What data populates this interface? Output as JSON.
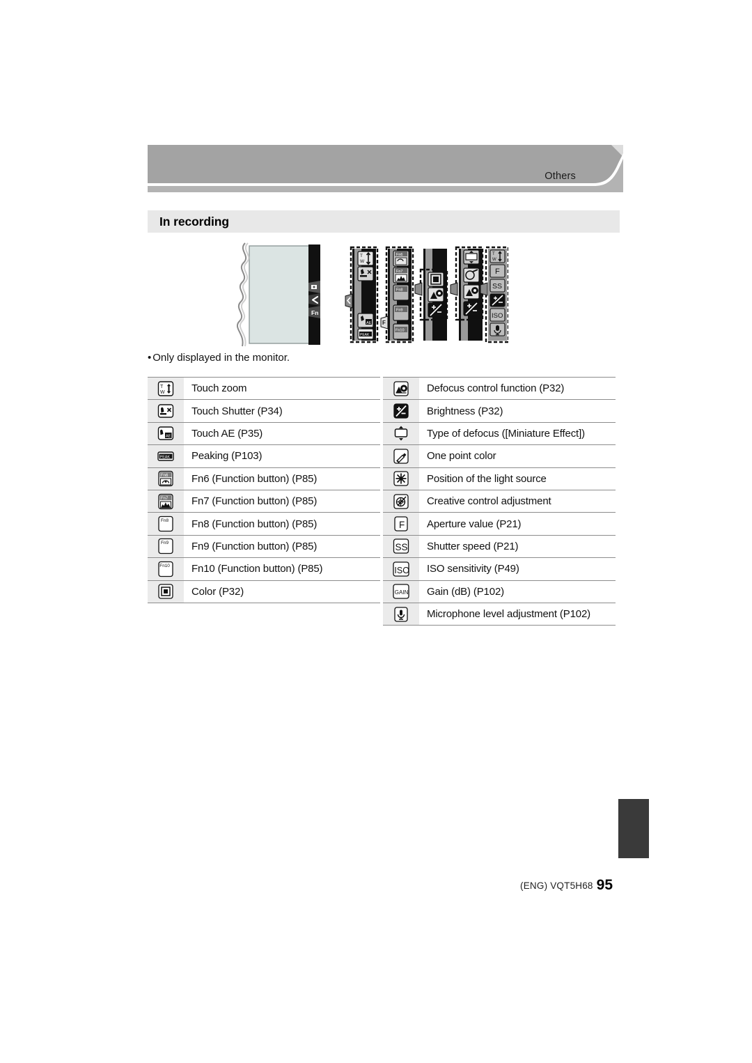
{
  "header": {
    "chapter_label": "Others"
  },
  "section": {
    "title": "In recording"
  },
  "note": {
    "bullet": "•",
    "text": "Only displayed in the monitor."
  },
  "illustration": {
    "monitor_tab_icons": [
      "playback-icon",
      "chevron-left-icon",
      "Fn"
    ],
    "strip1_icons": [
      "touch-zoom-icon",
      "touch-shutter-icon",
      "touch-ae-icon",
      "peaking-icon"
    ],
    "strip1_tab": "touch-tab-icon",
    "strip2_icons": [
      "Fn6",
      "Fn7",
      "Fn8",
      "Fn9",
      "Fn10"
    ],
    "strip2_tab": "F",
    "strip3_icons": [
      "color-icon",
      "defocus-icon",
      "brightness-icon"
    ],
    "strip3_tab": "creative-tab-icon",
    "strip4_icons": [
      "miniature-type-icon",
      "one-point-color-icon",
      "defocus-icon",
      "brightness-icon"
    ],
    "strip4_tab": "creative-tab-icon",
    "strip5_icons": [
      "touch-zoom-icon",
      "F",
      "SS",
      "brightness-icon",
      "ISO",
      "mic-icon"
    ],
    "strip5_tab": "touch-tab-icon"
  },
  "tables": {
    "left": [
      {
        "icon": "touch-zoom-icon",
        "label": "Touch zoom"
      },
      {
        "icon": "touch-shutter-icon",
        "label": "Touch Shutter (P34)"
      },
      {
        "icon": "touch-ae-icon",
        "label": "Touch AE (P35)"
      },
      {
        "icon": "peaking-icon",
        "label": "Peaking (P103)"
      },
      {
        "icon": "fn6-icon",
        "label": "Fn6 (Function button) (P85)"
      },
      {
        "icon": "fn7-icon",
        "label": "Fn7 (Function button) (P85)"
      },
      {
        "icon": "fn8-icon",
        "label": "Fn8 (Function button) (P85)"
      },
      {
        "icon": "fn9-icon",
        "label": "Fn9 (Function button) (P85)"
      },
      {
        "icon": "fn10-icon",
        "label": "Fn10 (Function button) (P85)"
      },
      {
        "icon": "color-icon",
        "label": "Color (P32)"
      }
    ],
    "right": [
      {
        "icon": "defocus-control-icon",
        "label": "Defocus control function (P32)"
      },
      {
        "icon": "brightness-icon",
        "label": "Brightness (P32)"
      },
      {
        "icon": "miniature-type-icon",
        "label": "Type of defocus ([Miniature Effect])"
      },
      {
        "icon": "one-point-color-icon",
        "label": "One point color"
      },
      {
        "icon": "light-source-icon",
        "label": "Position of the light source"
      },
      {
        "icon": "creative-control-icon",
        "label": "Creative control adjustment"
      },
      {
        "icon": "aperture-icon",
        "label": "Aperture value (P21)"
      },
      {
        "icon": "shutter-speed-icon",
        "label": "Shutter speed (P21)"
      },
      {
        "icon": "iso-icon",
        "label": "ISO sensitivity (P49)"
      },
      {
        "icon": "gain-icon",
        "label": "Gain (dB) (P102)"
      },
      {
        "icon": "microphone-icon",
        "label": "Microphone level adjustment (P102)"
      }
    ]
  },
  "footer": {
    "code": "(ENG) VQT5H68",
    "page": "95"
  },
  "colors": {
    "header_band": "#a3a3a3",
    "header_band_light": "#b3b3b3",
    "section_bar": "#e8e8e8",
    "icon_cell_bg": "#ebebeb",
    "rule": "#8c8c8c",
    "edge_tab": "#3a3a3a",
    "monitor_screen": "#dbe4e3"
  }
}
